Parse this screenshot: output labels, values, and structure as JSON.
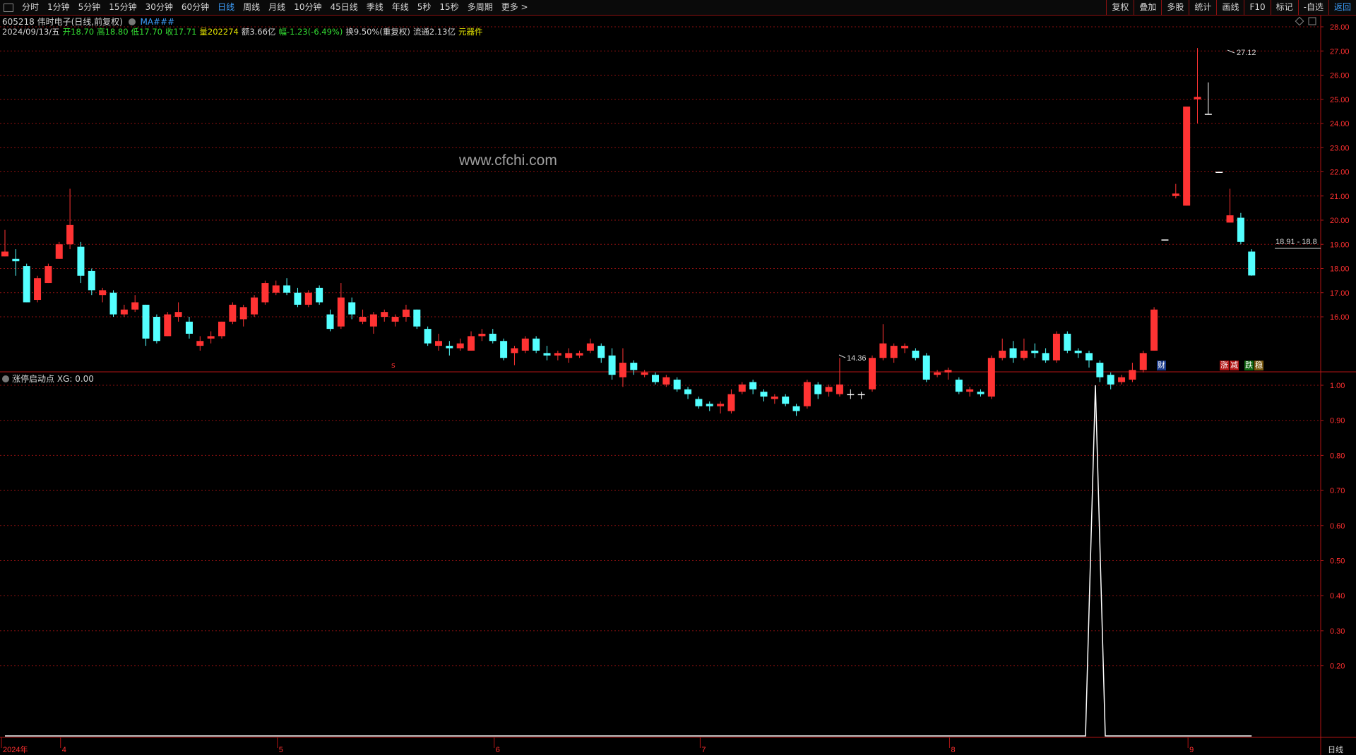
{
  "toolbar": {
    "period_tabs": [
      "分时",
      "1分钟",
      "5分钟",
      "15分钟",
      "30分钟",
      "60分钟",
      "日线",
      "周线",
      "月线",
      "10分钟",
      "45日线",
      "季线",
      "年线",
      "5秒",
      "15秒",
      "多周期",
      "更多 >"
    ],
    "active_tab": "日线",
    "right_buttons": [
      "复权",
      "叠加",
      "多股",
      "统计",
      "画线",
      "F10",
      "标记",
      "-自选",
      "返回"
    ]
  },
  "header": {
    "title": "605218 伟时电子(日线,前复权)",
    "ma_label": "MA###",
    "date": "2024/09/13/五",
    "open": "开18.70",
    "high": "高18.80",
    "low": "低17.70",
    "close": "收17.71",
    "volume": "量202274",
    "amount": "额3.66亿",
    "change": "幅-1.23(-6.49%)",
    "turnover": "换9.50%(重复权)",
    "float_cap": "流通2.13亿",
    "sector": "元器件"
  },
  "watermark": "www.cfchi.com",
  "indicator": {
    "label": "涨停启动点 XG: 0.00"
  },
  "badges": {
    "s_marker": "s",
    "fin": "财",
    "zhang": "涨",
    "jian": "减",
    "die": "跌",
    "wen": "稳"
  },
  "chart_data": {
    "type": "candlestick",
    "main_axis": {
      "min": 14.0,
      "max": 28.3,
      "tick_labels": [
        "28.00",
        "27.00",
        "26.00",
        "25.00",
        "24.00",
        "23.00",
        "22.00",
        "21.00",
        "20.00",
        "19.00",
        "18.00",
        "17.00",
        "16.00"
      ]
    },
    "indicator_axis": {
      "min": 0,
      "max": 1.0,
      "tick_labels": [
        "1.00",
        "0.90",
        "0.80",
        "0.70",
        "0.60",
        "0.50",
        "0.40",
        "0.30",
        "0.20"
      ]
    },
    "x_axis_labels": [
      "2024年",
      "4",
      "5",
      "6",
      "7",
      "8",
      "9"
    ],
    "x_axis_label_candle_index": [
      0,
      5,
      25,
      45,
      64,
      87,
      109
    ],
    "bottom_period_label": "日线",
    "annotations": {
      "high_label": "27.12",
      "low_label": "14.36",
      "price_range_label": "18.91 - 18.8"
    },
    "candles": [
      {
        "o": 18.5,
        "c": 18.7,
        "h": 19.6,
        "l": 18.5
      },
      {
        "o": 18.4,
        "c": 18.3,
        "h": 18.8,
        "l": 17.7
      },
      {
        "o": 18.1,
        "c": 16.6,
        "h": 18.2,
        "l": 16.6
      },
      {
        "o": 16.7,
        "c": 17.6,
        "h": 17.7,
        "l": 16.6
      },
      {
        "o": 17.4,
        "c": 18.1,
        "h": 18.2,
        "l": 17.4
      },
      {
        "o": 18.4,
        "c": 19.0,
        "h": 19.1,
        "l": 18.4
      },
      {
        "o": 19.0,
        "c": 19.8,
        "h": 21.3,
        "l": 18.8
      },
      {
        "o": 18.9,
        "c": 17.7,
        "h": 19.1,
        "l": 17.4
      },
      {
        "o": 17.9,
        "c": 17.1,
        "h": 18.0,
        "l": 16.9
      },
      {
        "o": 16.9,
        "c": 17.1,
        "h": 17.2,
        "l": 16.6
      },
      {
        "o": 17.0,
        "c": 16.1,
        "h": 17.1,
        "l": 16.0
      },
      {
        "o": 16.1,
        "c": 16.3,
        "h": 16.5,
        "l": 16.0
      },
      {
        "o": 16.3,
        "c": 16.6,
        "h": 16.9,
        "l": 16.2
      },
      {
        "o": 16.5,
        "c": 15.1,
        "h": 16.5,
        "l": 14.8
      },
      {
        "o": 16.0,
        "c": 15.0,
        "h": 16.1,
        "l": 14.9
      },
      {
        "o": 15.2,
        "c": 16.1,
        "h": 16.2,
        "l": 15.2
      },
      {
        "o": 16.0,
        "c": 16.2,
        "h": 16.6,
        "l": 15.8
      },
      {
        "o": 15.8,
        "c": 15.3,
        "h": 16.0,
        "l": 15.1
      },
      {
        "o": 14.8,
        "c": 15.0,
        "h": 15.2,
        "l": 14.6
      },
      {
        "o": 15.1,
        "c": 15.2,
        "h": 15.4,
        "l": 14.9
      },
      {
        "o": 15.2,
        "c": 15.8,
        "h": 15.8,
        "l": 15.1
      },
      {
        "o": 15.8,
        "c": 16.5,
        "h": 16.6,
        "l": 15.7
      },
      {
        "o": 15.9,
        "c": 16.4,
        "h": 16.5,
        "l": 15.6
      },
      {
        "o": 16.1,
        "c": 16.8,
        "h": 16.9,
        "l": 16.0
      },
      {
        "o": 16.6,
        "c": 17.4,
        "h": 17.5,
        "l": 16.5
      },
      {
        "o": 17.0,
        "c": 17.3,
        "h": 17.5,
        "l": 16.9
      },
      {
        "o": 17.3,
        "c": 17.0,
        "h": 17.6,
        "l": 16.9
      },
      {
        "o": 17.0,
        "c": 16.5,
        "h": 17.2,
        "l": 16.4
      },
      {
        "o": 16.5,
        "c": 17.0,
        "h": 17.1,
        "l": 16.4
      },
      {
        "o": 17.2,
        "c": 16.6,
        "h": 17.3,
        "l": 16.5
      },
      {
        "o": 16.1,
        "c": 15.5,
        "h": 16.3,
        "l": 15.4
      },
      {
        "o": 15.6,
        "c": 16.8,
        "h": 17.4,
        "l": 15.5
      },
      {
        "o": 16.6,
        "c": 16.1,
        "h": 16.8,
        "l": 15.9
      },
      {
        "o": 15.8,
        "c": 16.0,
        "h": 16.3,
        "l": 15.7
      },
      {
        "o": 15.6,
        "c": 16.1,
        "h": 16.2,
        "l": 15.3
      },
      {
        "o": 16.0,
        "c": 16.2,
        "h": 16.3,
        "l": 15.8
      },
      {
        "o": 15.8,
        "c": 16.0,
        "h": 16.1,
        "l": 15.6
      },
      {
        "o": 16.0,
        "c": 16.3,
        "h": 16.5,
        "l": 15.8
      },
      {
        "o": 16.3,
        "c": 15.6,
        "h": 16.3,
        "l": 15.5
      },
      {
        "o": 15.5,
        "c": 14.9,
        "h": 15.6,
        "l": 14.8
      },
      {
        "o": 14.8,
        "c": 15.0,
        "h": 15.3,
        "l": 14.6
      },
      {
        "o": 14.8,
        "c": 14.7,
        "h": 15.0,
        "l": 14.4
      },
      {
        "o": 14.7,
        "c": 14.9,
        "h": 15.1,
        "l": 14.6
      },
      {
        "o": 14.6,
        "c": 15.2,
        "h": 15.4,
        "l": 14.6
      },
      {
        "o": 15.2,
        "c": 15.3,
        "h": 15.5,
        "l": 15.0
      },
      {
        "o": 15.3,
        "c": 15.0,
        "h": 15.5,
        "l": 14.9
      },
      {
        "o": 15.0,
        "c": 14.3,
        "h": 15.1,
        "l": 14.2
      },
      {
        "o": 14.5,
        "c": 14.7,
        "h": 14.8,
        "l": 14.0
      },
      {
        "o": 14.6,
        "c": 15.1,
        "h": 15.2,
        "l": 14.5
      },
      {
        "o": 15.1,
        "c": 14.6,
        "h": 15.2,
        "l": 14.5
      },
      {
        "o": 14.5,
        "c": 14.4,
        "h": 14.8,
        "l": 14.2
      },
      {
        "o": 14.4,
        "c": 14.5,
        "h": 14.6,
        "l": 14.2
      },
      {
        "o": 14.3,
        "c": 14.5,
        "h": 14.7,
        "l": 14.1
      },
      {
        "o": 14.4,
        "c": 14.5,
        "h": 14.6,
        "l": 14.3
      },
      {
        "o": 14.6,
        "c": 14.9,
        "h": 15.1,
        "l": 14.5
      },
      {
        "o": 14.8,
        "c": 14.3,
        "h": 14.9,
        "l": 14.1
      },
      {
        "o": 14.4,
        "c": 13.6,
        "h": 14.7,
        "l": 13.4
      },
      {
        "o": 13.5,
        "c": 14.1,
        "h": 14.7,
        "l": 13.1
      },
      {
        "o": 14.1,
        "c": 13.8,
        "h": 14.2,
        "l": 13.6
      },
      {
        "o": 13.6,
        "c": 13.7,
        "h": 13.8,
        "l": 13.5
      },
      {
        "o": 13.6,
        "c": 13.3,
        "h": 13.7,
        "l": 13.2
      },
      {
        "o": 13.2,
        "c": 13.5,
        "h": 13.6,
        "l": 13.1
      },
      {
        "o": 13.4,
        "c": 13.0,
        "h": 13.5,
        "l": 12.9
      },
      {
        "o": 13.0,
        "c": 12.8,
        "h": 13.1,
        "l": 12.6
      },
      {
        "o": 12.6,
        "c": 12.3,
        "h": 12.7,
        "l": 12.2
      },
      {
        "o": 12.4,
        "c": 12.3,
        "h": 12.5,
        "l": 12.1
      },
      {
        "o": 12.3,
        "c": 12.4,
        "h": 12.5,
        "l": 12.0
      },
      {
        "o": 12.1,
        "c": 12.8,
        "h": 13.0,
        "l": 12.0
      },
      {
        "o": 12.9,
        "c": 13.2,
        "h": 13.3,
        "l": 12.8
      },
      {
        "o": 13.3,
        "c": 13.0,
        "h": 13.4,
        "l": 12.8
      },
      {
        "o": 12.9,
        "c": 12.7,
        "h": 13.0,
        "l": 12.5
      },
      {
        "o": 12.6,
        "c": 12.7,
        "h": 12.8,
        "l": 12.4
      },
      {
        "o": 12.7,
        "c": 12.4,
        "h": 12.8,
        "l": 12.3
      },
      {
        "o": 12.3,
        "c": 12.1,
        "h": 12.4,
        "l": 11.9
      },
      {
        "o": 12.3,
        "c": 13.3,
        "h": 13.4,
        "l": 12.2
      },
      {
        "o": 13.2,
        "c": 12.8,
        "h": 13.3,
        "l": 12.6
      },
      {
        "o": 12.9,
        "c": 13.1,
        "h": 13.2,
        "l": 12.7
      },
      {
        "o": 12.8,
        "c": 13.2,
        "h": 14.3,
        "l": 12.7
      },
      {
        "o": 12.8,
        "c": 12.8,
        "h": 13.0,
        "l": 12.6
      },
      {
        "o": 12.8,
        "c": 12.8,
        "h": 12.9,
        "l": 12.6
      },
      {
        "o": 13.0,
        "c": 14.3,
        "h": 14.4,
        "l": 12.9
      },
      {
        "o": 14.3,
        "c": 14.9,
        "h": 15.7,
        "l": 14.2
      },
      {
        "o": 14.3,
        "c": 14.8,
        "h": 14.9,
        "l": 14.1
      },
      {
        "o": 14.7,
        "c": 14.8,
        "h": 14.9,
        "l": 14.5
      },
      {
        "o": 14.6,
        "c": 14.3,
        "h": 14.7,
        "l": 14.2
      },
      {
        "o": 14.4,
        "c": 13.4,
        "h": 14.5,
        "l": 13.3
      },
      {
        "o": 13.6,
        "c": 13.7,
        "h": 13.8,
        "l": 13.5
      },
      {
        "o": 13.7,
        "c": 13.8,
        "h": 13.9,
        "l": 13.4
      },
      {
        "o": 13.4,
        "c": 12.9,
        "h": 13.5,
        "l": 12.8
      },
      {
        "o": 12.9,
        "c": 13.0,
        "h": 13.1,
        "l": 12.7
      },
      {
        "o": 12.9,
        "c": 12.8,
        "h": 13.0,
        "l": 12.7
      },
      {
        "o": 12.7,
        "c": 14.3,
        "h": 14.4,
        "l": 12.6
      },
      {
        "o": 14.3,
        "c": 14.6,
        "h": 15.1,
        "l": 14.2
      },
      {
        "o": 14.7,
        "c": 14.3,
        "h": 15.0,
        "l": 14.1
      },
      {
        "o": 14.3,
        "c": 14.6,
        "h": 15.1,
        "l": 14.2
      },
      {
        "o": 14.6,
        "c": 14.5,
        "h": 14.9,
        "l": 14.3
      },
      {
        "o": 14.5,
        "c": 14.2,
        "h": 14.7,
        "l": 14.1
      },
      {
        "o": 14.2,
        "c": 15.3,
        "h": 15.4,
        "l": 14.1
      },
      {
        "o": 15.3,
        "c": 14.6,
        "h": 15.4,
        "l": 14.5
      },
      {
        "o": 14.6,
        "c": 14.5,
        "h": 14.7,
        "l": 14.3
      },
      {
        "o": 14.5,
        "c": 14.2,
        "h": 14.6,
        "l": 13.9
      },
      {
        "o": 14.1,
        "c": 13.5,
        "h": 14.2,
        "l": 13.3
      },
      {
        "o": 13.6,
        "c": 13.2,
        "h": 13.7,
        "l": 13.0
      },
      {
        "o": 13.3,
        "c": 13.5,
        "h": 13.6,
        "l": 13.2
      },
      {
        "o": 13.4,
        "c": 13.8,
        "h": 14.1,
        "l": 13.3
      },
      {
        "o": 13.8,
        "c": 14.5,
        "h": 14.6,
        "l": 13.7
      },
      {
        "o": 14.6,
        "c": 16.3,
        "h": 16.4,
        "l": 14.6
      },
      {
        "o": 19.2,
        "c": 19.2,
        "h": 19.2,
        "l": 19.2
      },
      {
        "o": 21.0,
        "c": 21.1,
        "h": 21.5,
        "l": 20.9
      },
      {
        "o": 20.6,
        "c": 24.7,
        "h": 24.7,
        "l": 20.6
      },
      {
        "o": 25.0,
        "c": 25.1,
        "h": 27.12,
        "l": 24.0
      },
      {
        "o": 24.4,
        "c": 24.4,
        "h": 25.7,
        "l": 24.4
      },
      {
        "o": 22.0,
        "c": 22.0,
        "h": 22.0,
        "l": 22.0
      },
      {
        "o": 19.9,
        "c": 20.2,
        "h": 21.3,
        "l": 19.9
      },
      {
        "o": 20.1,
        "c": 19.1,
        "h": 20.3,
        "l": 19.0
      },
      {
        "o": 18.7,
        "c": 17.71,
        "h": 18.8,
        "l": 17.7
      }
    ],
    "indicator_series": {
      "name": "XG",
      "peak_candle_index": 100,
      "peak_value": 1.0
    }
  },
  "colors": {
    "up": "#ff3333",
    "down": "#54ffff",
    "grid": "#8b1010",
    "frame": "#b01515",
    "axis_text": "#ff3030",
    "indicator_line": "#ffffff"
  }
}
